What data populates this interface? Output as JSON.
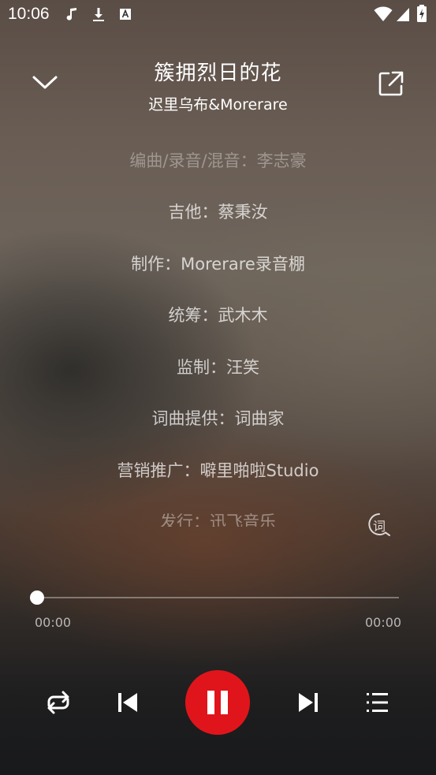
{
  "status_bar": {
    "time": "10:06",
    "icons": [
      "music-note-icon",
      "download-icon",
      "text-icon",
      "wifi-icon",
      "signal-icon",
      "battery-charging-icon"
    ]
  },
  "header": {
    "title": "簇拥烈日的花",
    "artist": "迟里乌布&Morerare",
    "collapse_icon": "chevron-down-icon",
    "share_icon": "share-icon"
  },
  "lyrics": {
    "lines": [
      "编曲/录音/混音：李志豪",
      "吉他：蔡秉汝",
      "制作：Morerare录音棚",
      "统筹：武木木",
      "监制：汪笑",
      "词曲提供：词曲家",
      "营销推广：噼里啪啦Studio",
      "发行：迅飞音乐"
    ],
    "lyric_button_label": "词"
  },
  "player": {
    "progress": 0,
    "current_time": "00:00",
    "total_time": "00:00",
    "accent_color": "#e0151b",
    "controls": [
      "repeat-icon",
      "previous-icon",
      "pause-icon",
      "next-icon",
      "playlist-icon"
    ]
  }
}
